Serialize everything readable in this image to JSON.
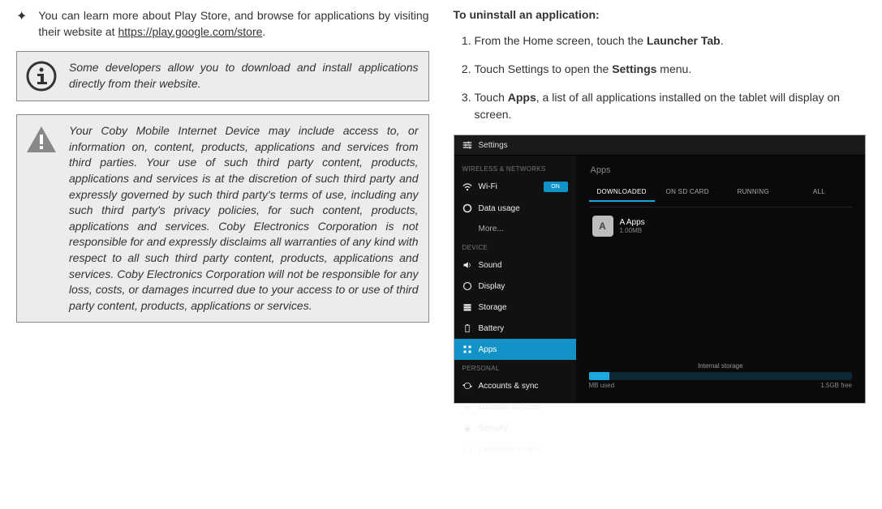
{
  "left": {
    "bullet": {
      "prefix": "You can learn more about Play Store, and browse for applications by visiting their website at ",
      "link_text": "https://play.google.com/store",
      "suffix": "."
    },
    "info_box": "Some developers allow you to download and install applications directly from their website.",
    "warn_box": "Your Coby Mobile Internet Device may include access to, or information on, content, products, applications and services from third parties. Your use of such third party content, products, applications and services is at the discretion of such third party and expressly governed by such third party's terms of use, including any such third party's privacy policies, for such content, products, applications and services. Coby Electronics Corporation is not responsible for and expressly disclaims all warranties of any kind with respect to all such third party content, products, applications and services. Coby Electronics Corporation will not be responsible for any loss, costs, or damages incurred due to your access to or use of third party content, products, applications or services."
  },
  "right": {
    "heading": "To uninstall an application:",
    "steps": [
      {
        "pre": "From the Home screen, touch the ",
        "bold": "Launcher Tab",
        "post": "."
      },
      {
        "pre": "Touch Settings to open the ",
        "bold": "Settings",
        "post": " menu."
      },
      {
        "pre": "Touch ",
        "bold": "Apps",
        "post": ", a list of all applications installed on the tablet will display on screen."
      }
    ],
    "screenshot": {
      "title": "Settings",
      "side_head1": "WIRELESS & NETWORKS",
      "side_head2": "DEVICE",
      "side_head3": "PERSONAL",
      "wifi": "Wi-Fi",
      "wifi_toggle": "ON",
      "data_usage": "Data usage",
      "more": "More...",
      "sound": "Sound",
      "display": "Display",
      "storage": "Storage",
      "battery": "Battery",
      "apps": "Apps",
      "accounts": "Accounts & sync",
      "location": "Location services",
      "security": "Security",
      "lang": "Language & input",
      "main_title": "Apps",
      "tabs": {
        "downloaded": "DOWNLOADED",
        "sd": "ON SD CARD",
        "running": "RUNNING",
        "all": "ALL"
      },
      "app_name": "A Apps",
      "app_sub": "1.00MB",
      "strip_label": "Internal storage",
      "strip_left": "MB used",
      "strip_right": "1.5GB free"
    }
  }
}
